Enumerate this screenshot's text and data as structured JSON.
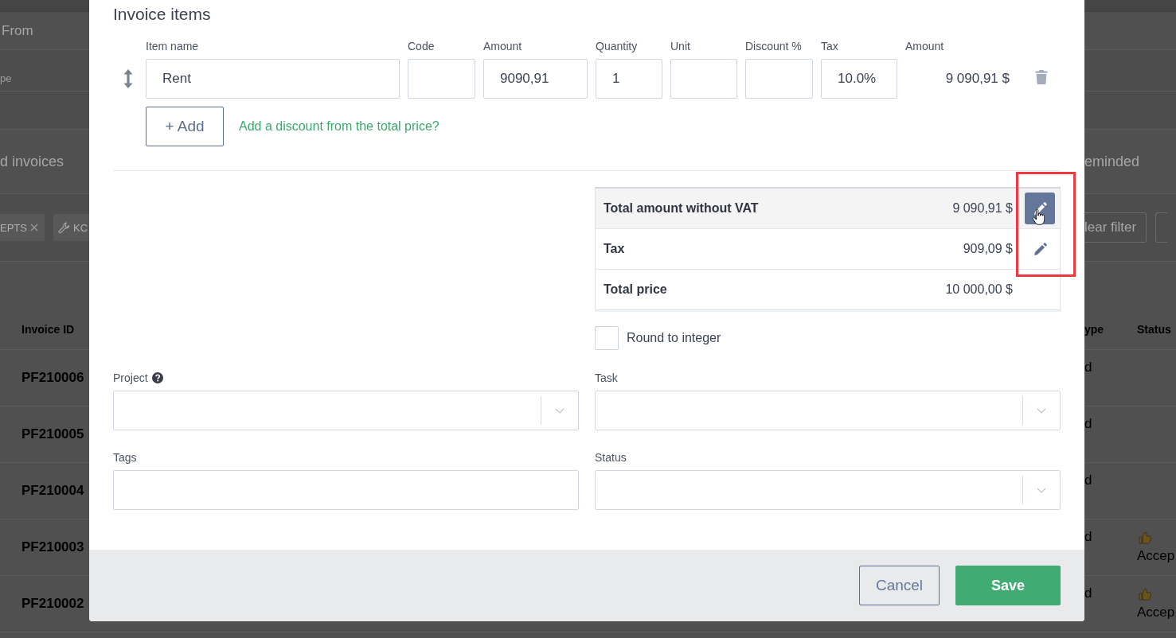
{
  "background_page": {
    "filter_labels": [
      "From",
      "pe"
    ],
    "filter_tabs": [
      "d invoices",
      "eminded"
    ],
    "filter_chips": [
      {
        "label": "EPTS",
        "kind": "removable"
      },
      {
        "label": "KC",
        "kind": "tool"
      }
    ],
    "filter_button": "lear filter",
    "table": {
      "columns": [
        "Invoice ID",
        "ype",
        "Status"
      ],
      "rows": [
        {
          "invoice_id": "PF210006",
          "column_2": "d"
        },
        {
          "invoice_id": "PF210005",
          "column_2": "d"
        },
        {
          "invoice_id": "PF210004",
          "column_2": "d"
        },
        {
          "invoice_id": "PF210003",
          "column_2": "d",
          "status": "Accep"
        },
        {
          "invoice_id": "PF210002",
          "column_2": "d",
          "status": "Accep"
        }
      ]
    }
  },
  "modal": {
    "section_title": "Invoice items",
    "item_columns": [
      "Item name",
      "Code",
      "Amount",
      "Quantity",
      "Unit",
      "Discount %",
      "Tax",
      "Amount"
    ],
    "items": [
      {
        "item_name": "Rent",
        "amount": "9090,91",
        "quantity": "1",
        "tax": "10.0%",
        "line_total": "9 090,91 $"
      }
    ],
    "add_button": "+ Add",
    "discount_link": "Add a discount from the total price?",
    "totals": {
      "highlighted": true,
      "rows": [
        {
          "label": "Total amount without VAT",
          "value": "9 090,91 $",
          "editable": true,
          "hovered": true
        },
        {
          "label": "Tax",
          "value": "909,09 $",
          "editable": true,
          "hovered": false
        },
        {
          "label": "Total price",
          "value": "10 000,00 $",
          "editable": false,
          "hovered": false
        }
      ]
    },
    "round_to_integer": {
      "label": "Round to integer",
      "checked": false
    },
    "fields": [
      {
        "label": "Project",
        "kind": "select",
        "help": true
      },
      {
        "label": "Task",
        "kind": "select",
        "help": false
      },
      {
        "label": "Tags",
        "kind": "input",
        "help": false
      },
      {
        "label": "Status",
        "kind": "select",
        "help": false
      }
    ],
    "buttons": [
      {
        "label": "Cancel",
        "kind": "secondary"
      },
      {
        "label": "Save",
        "kind": "primary"
      }
    ]
  }
}
